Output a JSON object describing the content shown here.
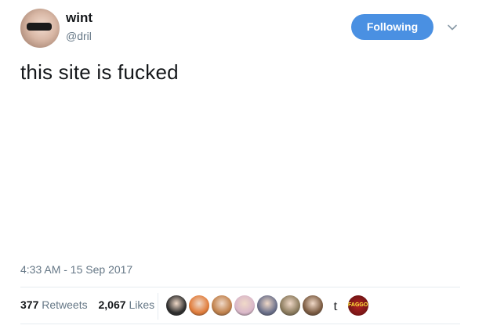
{
  "tweet": {
    "display_name": "wint",
    "username": "@dril",
    "follow_label": "Following",
    "text": "this site is fucked",
    "timestamp": "4:33 AM - 15 Sep 2017"
  },
  "stats": {
    "retweets_count": "377",
    "retweets_label": "Retweets",
    "likes_count": "2,067",
    "likes_label": "Likes"
  },
  "likers": [
    {
      "type": "avatar",
      "color": "#2b2b2b"
    },
    {
      "type": "avatar",
      "color": "#e07b39"
    },
    {
      "type": "avatar",
      "color": "#c0804a"
    },
    {
      "type": "avatar",
      "color": "#d9b7c9"
    },
    {
      "type": "avatar",
      "color": "#6a6f8a"
    },
    {
      "type": "avatar",
      "color": "#8a7a5c"
    },
    {
      "type": "avatar",
      "color": "#7a5a40"
    },
    {
      "type": "letter",
      "text": "t"
    },
    {
      "type": "logo",
      "text": "FAGGOT",
      "color": "#b22222"
    }
  ],
  "colors": {
    "accent": "#4a90e2",
    "secondary_text": "#657786",
    "primary_text": "#14171a"
  }
}
